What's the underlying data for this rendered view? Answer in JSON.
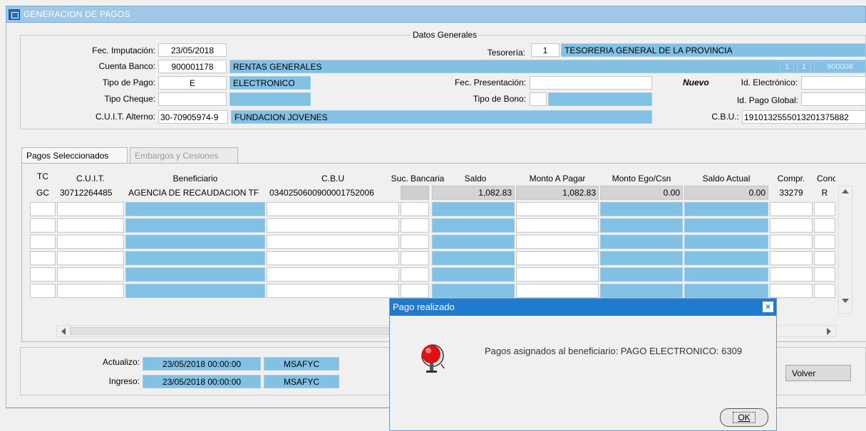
{
  "window": {
    "title": "GENERACION DE PAGOS"
  },
  "general": {
    "section_title": "Datos Generales",
    "fec_imputacion_label": "Fec. Imputación:",
    "fec_imputacion": "23/05/2018",
    "tesoreria_label": "Tesorería:",
    "tesoreria_code": "1",
    "tesoreria_name": "TESORERIA GENERAL DE LA PROVINCIA",
    "cuenta_banco_label": "Cuenta Banco:",
    "cuenta_banco": "900001178",
    "cuenta_banco_name": "RENTAS GENERALES",
    "cuenta_extra_1": "1",
    "cuenta_extra_2": "1",
    "cuenta_extra_3": "900008",
    "tipo_pago_label": "Tipo de Pago:",
    "tipo_pago": "E",
    "tipo_pago_name": "ELECTRONICO",
    "fec_presentacion_label": "Fec. Presentación:",
    "fec_presentacion": "",
    "nuevo_label": "Nuevo",
    "id_electronico_label": "Id. Electrónico:",
    "id_electronico": "",
    "tipo_cheque_label": "Tipo Cheque:",
    "tipo_cheque": "",
    "tipo_bono_label": "Tipo de Bono:",
    "id_pago_global_label": "Id. Pago Global:",
    "id_pago_global": "",
    "cuit_alterno_label": "C.U.I.T. Alterno:",
    "cuit_alterno": "30-70905974-9",
    "cuit_alterno_name": "FUNDACION JOVENES",
    "cbu_label": "C.B.U.:",
    "cbu": "1910132555013201375882"
  },
  "tabs": [
    {
      "label": "Pagos Seleccionados",
      "active": true
    },
    {
      "label": "Embargos y Cesiones",
      "active": false
    }
  ],
  "table": {
    "headers": [
      "TC",
      "C.U.I.T.",
      "Beneficiario",
      "C.B.U",
      "Suc. Bancaria",
      "Saldo",
      "Monto A Pagar",
      "Monto Ego/Csn",
      "Saldo Actual",
      "Compr.",
      "Conc"
    ],
    "rows": [
      {
        "tc": "GC",
        "cuit": "30712264485",
        "beneficiario": "AGENCIA DE RECAUDACION TF",
        "cbu": "0340250600900001752006",
        "suc": "",
        "saldo": "1,082.83",
        "monto": "1,082.83",
        "ego": "0.00",
        "actual": "0.00",
        "compr": "33279",
        "conc": "R"
      }
    ]
  },
  "audit": {
    "actualizo_label": "Actualizo:",
    "actualizo_date": "23/05/2018 00:00:00",
    "actualizo_user": "MSAFYC",
    "ingreso_label": "Ingreso:",
    "ingreso_date": "23/05/2018 00:00:00",
    "ingreso_user": "MSAFYC"
  },
  "buttons": {
    "volver": "Volver"
  },
  "dialog": {
    "title": "Pago realizado",
    "message": "Pagos asignados al beneficiario: PAGO ELECTRONICO: 6309",
    "ok": "OK"
  },
  "colors": {
    "accent": "#82c0e4",
    "titlebar": "#9fc7e8",
    "dialog_title": "#1e7bd0"
  }
}
